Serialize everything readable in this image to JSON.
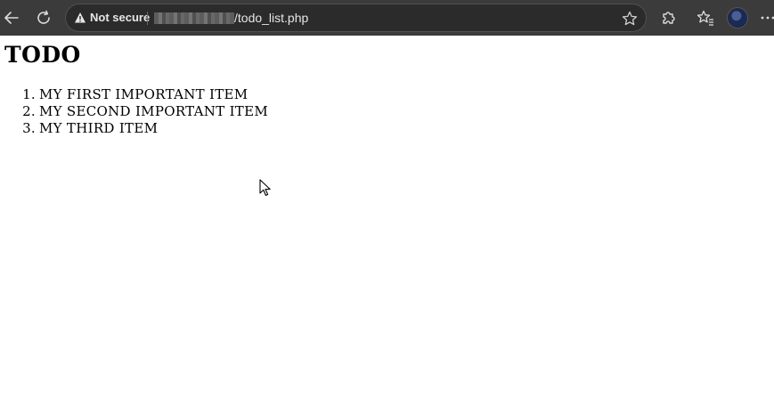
{
  "browser": {
    "security_label": "Not secure",
    "url_path": "/todo_list.php"
  },
  "page": {
    "title": "TODO",
    "items": [
      {
        "number": "1.",
        "label": "My first important item"
      },
      {
        "number": "2.",
        "label": "My second important item"
      },
      {
        "number": "3.",
        "label": "My third item"
      }
    ]
  },
  "icons": {
    "back": "back-arrow-icon",
    "refresh": "refresh-icon",
    "warning": "warning-triangle-icon",
    "favorite": "star-icon",
    "extensions": "puzzle-icon",
    "favorites": "favorites-icon",
    "profile": "avatar",
    "menu": "more-horizontal-icon"
  },
  "colors": {
    "chrome_bg": "#3b3b3b",
    "address_bg": "#2b2b2b",
    "chrome_text": "#e6e6e6",
    "page_bg": "#ffffff",
    "page_text": "#000000"
  }
}
